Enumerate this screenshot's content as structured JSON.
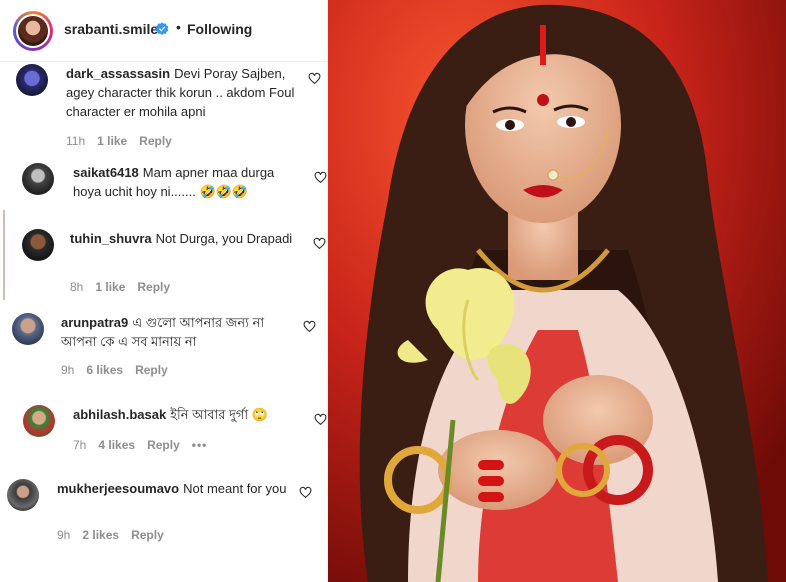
{
  "post": {
    "username": "srabanti.smile",
    "separator": "•",
    "follow_status": "Following"
  },
  "comments": [
    {
      "user": "dark_assassasin",
      "text": "Devi Poray Sajben, agey character thik korun .. akdom Foul character er mohila apni",
      "time": "11h",
      "likes": "1 like",
      "reply": "Reply"
    },
    {
      "user": "saikat6418",
      "text": "Mam apner maa durga hoya uchit hoy ni....... 🤣🤣🤣",
      "time": "",
      "likes": "",
      "reply": ""
    },
    {
      "user": "tuhin_shuvra",
      "text": "Not Durga, you Drapadi",
      "time": "8h",
      "likes": "1 like",
      "reply": "Reply"
    },
    {
      "user": "arunpatra9",
      "text": "এ গুলো আপনার জন্য না আপনা কে এ সব মানায় না",
      "time": "9h",
      "likes": "6 likes",
      "reply": "Reply"
    },
    {
      "user": "abhilash.basak",
      "text": "ইনি আবার দুর্গা 🙄",
      "time": "7h",
      "likes": "4 likes",
      "reply": "Reply",
      "more": "•••"
    },
    {
      "user": "mukherjeesoumavo",
      "text": "Not meant for you",
      "time": "9h",
      "likes": "2 likes",
      "reply": "Reply"
    }
  ],
  "colors": {
    "verified": "#3897f0",
    "muted": "#8e8e8e",
    "text": "#262626"
  },
  "icons": {
    "verified": "verified-badge-icon",
    "like": "heart-outline-icon"
  }
}
